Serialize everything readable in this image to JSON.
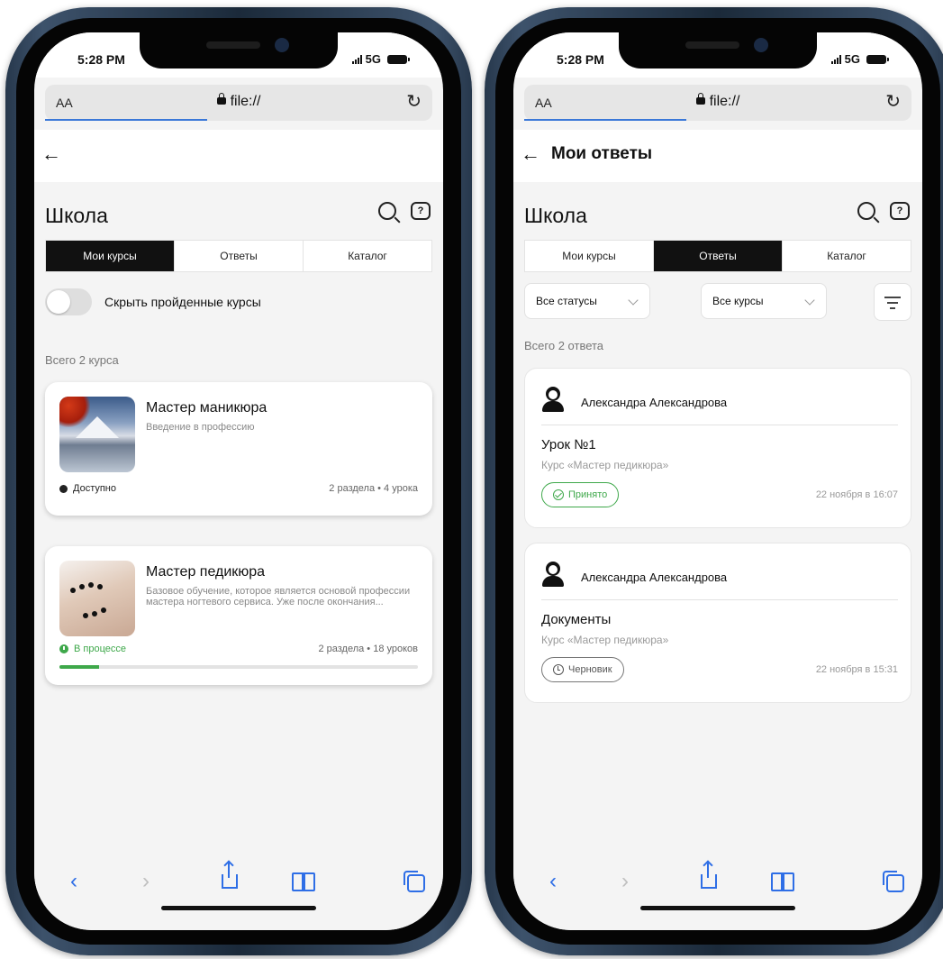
{
  "device": {
    "time": "5:28 PM",
    "network": "5G"
  },
  "browser": {
    "text_size": "AA",
    "url": "file://"
  },
  "left": {
    "title": "Школа",
    "tabs": [
      {
        "label": "Мои курсы",
        "active": true
      },
      {
        "label": "Ответы",
        "active": false
      },
      {
        "label": "Каталог",
        "active": false
      }
    ],
    "toggle_label": "Скрыть пройденные курсы",
    "total": "Всего 2 курса",
    "courses": [
      {
        "title": "Мастер маникюра",
        "description": "Введение в профессию",
        "status": "Доступно",
        "meta": "2 раздела • 4 урока"
      },
      {
        "title": "Мастер педикюра",
        "description": "Базовое обучение, которое является основой профессии мастера ногтевого сервиса. Уже после окончания...",
        "status": "В процессе",
        "meta": "2 раздела • 18 уроков",
        "progress": 0.11
      }
    ]
  },
  "right": {
    "page_title": "Мои ответы",
    "title": "Школа",
    "tabs": [
      {
        "label": "Мои курсы",
        "active": false
      },
      {
        "label": "Ответы",
        "active": true
      },
      {
        "label": "Каталог",
        "active": false
      }
    ],
    "filters": {
      "status": "Все статусы",
      "course": "Все курсы"
    },
    "total": "Всего 2 ответа",
    "answers": [
      {
        "author": "Александра Александрова",
        "lesson": "Урок №1",
        "course": "Курс «Мастер педикюра»",
        "status": "Принято",
        "date": "22 ноября в 16:07"
      },
      {
        "author": "Александра Александрова",
        "lesson": "Документы",
        "course": "Курс «Мастер педикюра»",
        "status": "Черновик",
        "date": "22 ноября в 15:31"
      }
    ]
  },
  "colors": {
    "accent": "#2e6ee6",
    "success": "#3ea84a",
    "active_tab": "#111111"
  }
}
